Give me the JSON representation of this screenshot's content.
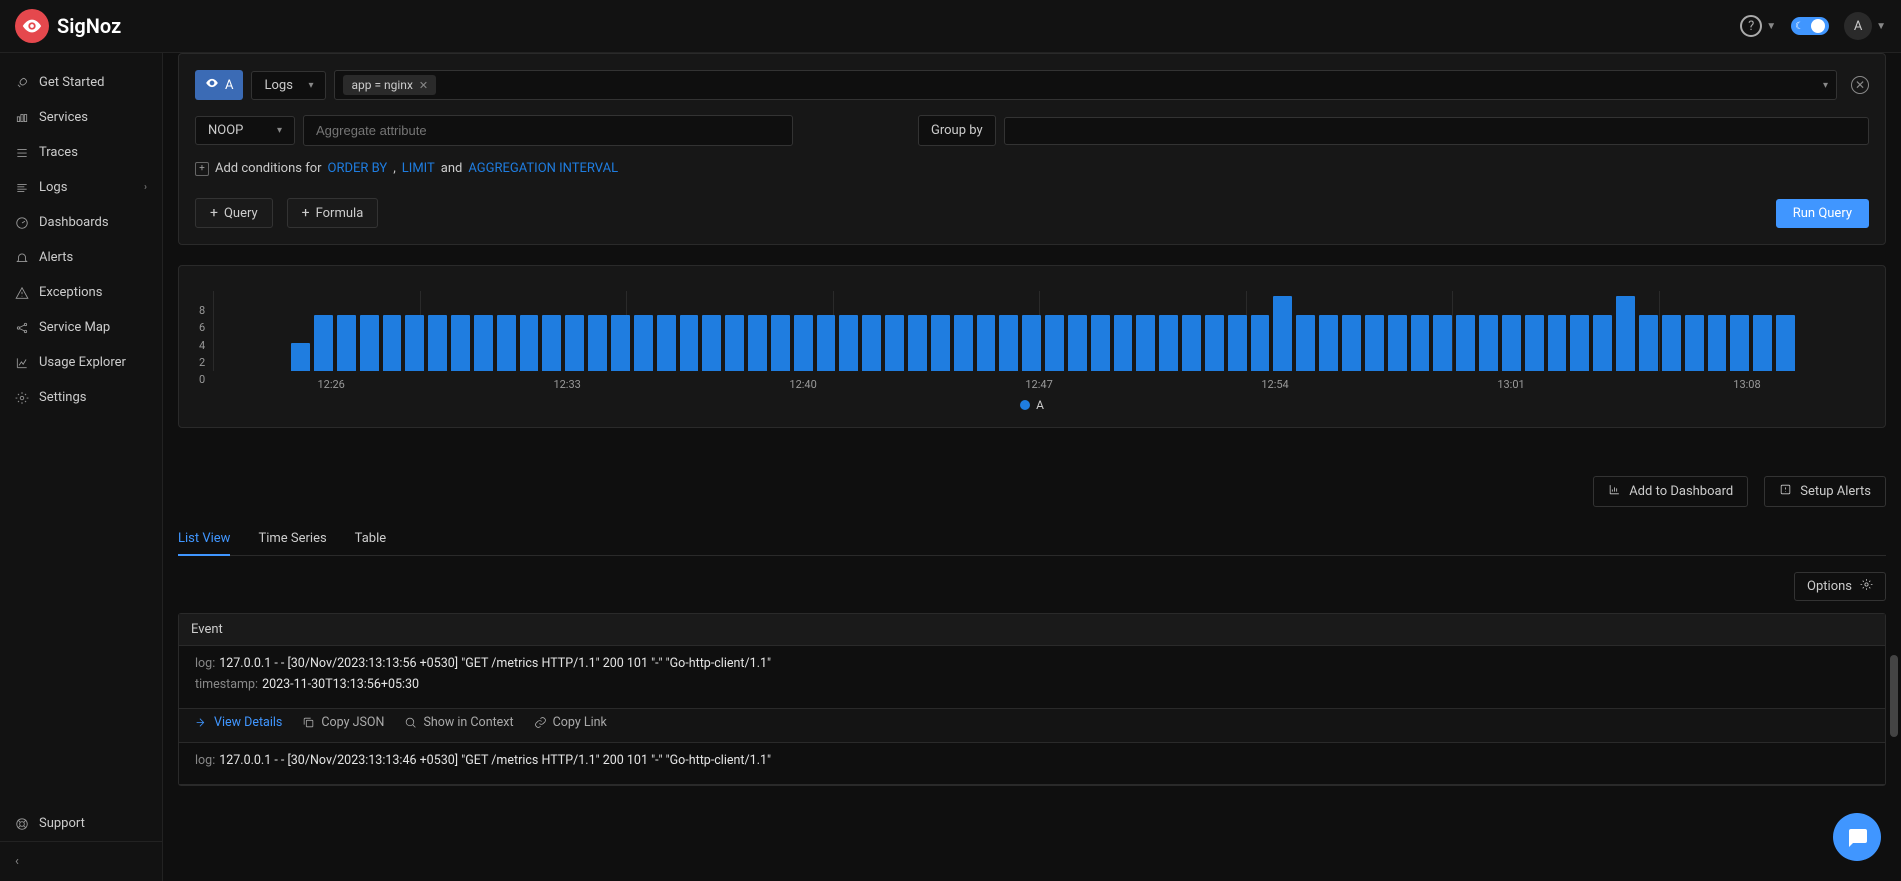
{
  "brand": "SigNoz",
  "avatar_initial": "A",
  "sidebar": {
    "items": [
      {
        "label": "Get Started",
        "icon": "rocket"
      },
      {
        "label": "Services",
        "icon": "bars"
      },
      {
        "label": "Traces",
        "icon": "list"
      },
      {
        "label": "Logs",
        "icon": "align",
        "chevron": true
      },
      {
        "label": "Dashboards",
        "icon": "dashboard"
      },
      {
        "label": "Alerts",
        "icon": "bell"
      },
      {
        "label": "Exceptions",
        "icon": "warning"
      },
      {
        "label": "Service Map",
        "icon": "share"
      },
      {
        "label": "Usage Explorer",
        "icon": "chart"
      },
      {
        "label": "Settings",
        "icon": "gear"
      }
    ],
    "support_label": "Support"
  },
  "query": {
    "badge": "A",
    "source": "Logs",
    "filter_chip": "app = nginx",
    "noop": "NOOP",
    "aggregate_placeholder": "Aggregate attribute",
    "group_by": "Group by",
    "conditions_prefix": "Add conditions for",
    "order_by": "ORDER BY",
    "limit": "LIMIT",
    "and": "and",
    "agg_interval": "AGGREGATION INTERVAL",
    "comma": ",",
    "query_btn": "Query",
    "formula_btn": "Formula",
    "run_btn": "Run Query"
  },
  "chart_data": {
    "type": "bar",
    "y_ticks": [
      "8",
      "6",
      "4",
      "2",
      "0"
    ],
    "x_ticks": [
      "12:26",
      "12:33",
      "12:40",
      "12:47",
      "12:54",
      "13:01",
      "13:08"
    ],
    "values": [
      3,
      6,
      6,
      6,
      6,
      6,
      6,
      6,
      6,
      6,
      6,
      6,
      6,
      6,
      6,
      6,
      6,
      6,
      6,
      6,
      6,
      6,
      6,
      6,
      6,
      6,
      6,
      6,
      6,
      6,
      6,
      6,
      6,
      6,
      6,
      6,
      6,
      6,
      6,
      6,
      6,
      6,
      6,
      8,
      6,
      6,
      6,
      6,
      6,
      6,
      6,
      6,
      6,
      6,
      6,
      6,
      6,
      6,
      8,
      6,
      6,
      6,
      6,
      6,
      6,
      6
    ],
    "ylim": [
      0,
      8
    ],
    "legend": "A"
  },
  "actions": {
    "add_dashboard": "Add to Dashboard",
    "setup_alerts": "Setup Alerts"
  },
  "tabs": {
    "list": "List View",
    "timeseries": "Time Series",
    "table": "Table"
  },
  "options_label": "Options",
  "logs": {
    "header": "Event",
    "log_key": "log:",
    "timestamp_key": "timestamp:",
    "rows": [
      {
        "log": "127.0.0.1 - - [30/Nov/2023:13:13:56 +0530] \"GET /metrics HTTP/1.1\" 200 101 \"-\" \"Go-http-client/1.1\"",
        "timestamp": "2023-11-30T13:13:56+05:30"
      },
      {
        "log": "127.0.0.1 - - [30/Nov/2023:13:13:46 +0530] \"GET /metrics HTTP/1.1\" 200 101 \"-\" \"Go-http-client/1.1\""
      }
    ],
    "view_details": "View Details",
    "copy_json": "Copy JSON",
    "show_context": "Show in Context",
    "copy_link": "Copy Link"
  }
}
